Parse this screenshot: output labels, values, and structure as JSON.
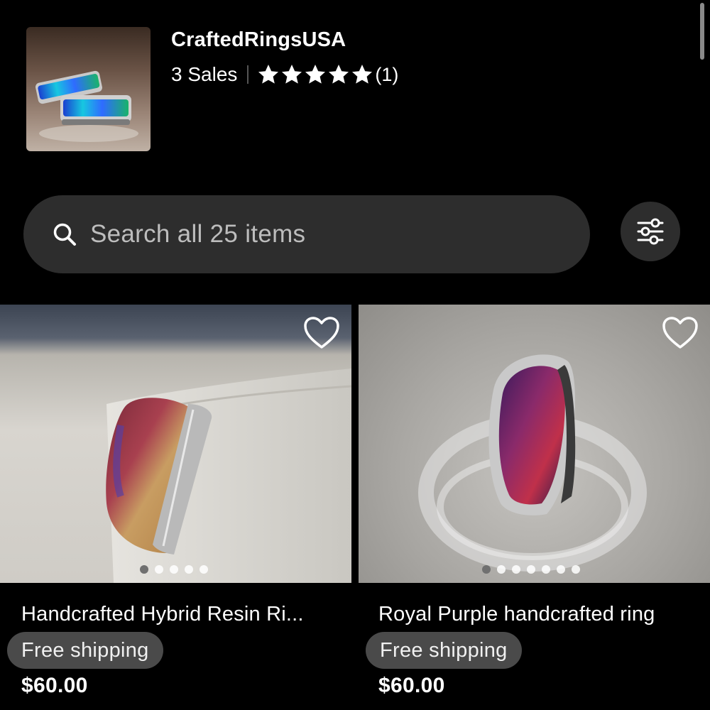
{
  "shop": {
    "name": "CraftedRingsUSA",
    "sales": "3 Sales",
    "rating_stars": 5,
    "review_count": "(1)",
    "thumb_icon": "rings-photo"
  },
  "search": {
    "placeholder": "Search all 25 items",
    "icon": "search-icon",
    "filter_icon": "sliders-icon"
  },
  "listings": [
    {
      "title": "Handcrafted Hybrid Resin Ri...",
      "shipping": "Free shipping",
      "price": "$60.00",
      "image_count": 5,
      "active_image": 0,
      "favorited": false
    },
    {
      "title": "Royal Purple handcrafted ring",
      "shipping": "Free shipping",
      "price": "$60.00",
      "image_count": 7,
      "active_image": 0,
      "favorited": false
    }
  ],
  "colors": {
    "background": "#000000",
    "search_bg": "#2d2d2d",
    "badge_bg": "#4a4a4a",
    "text": "#ffffff",
    "placeholder": "#bdbdbd"
  }
}
